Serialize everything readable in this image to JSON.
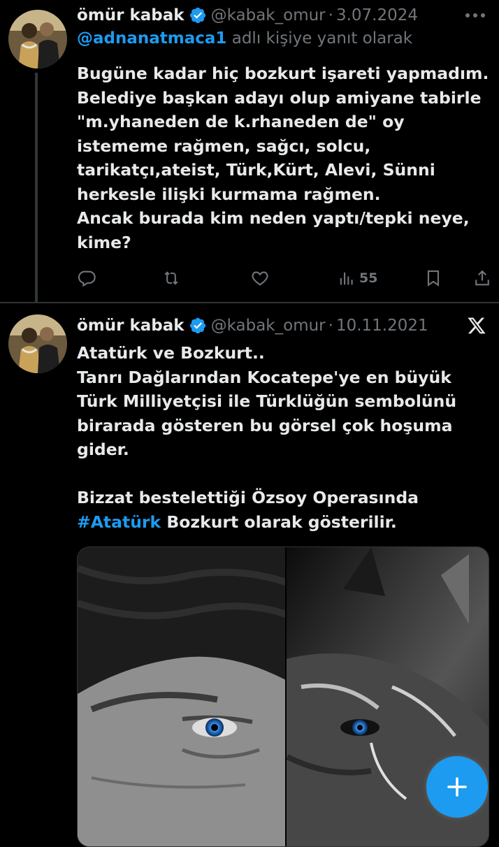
{
  "tweets": [
    {
      "author_name": "ömür kabak",
      "handle": "@kabak_omur",
      "separator": "·",
      "date": "3.07.2024",
      "reply_to_mention": "@adnanatmaca1",
      "reply_to_suffix": "adlı kişiye yanıt olarak",
      "lines": [
        "Bugüne kadar hiç bozkurt işareti yapmadım.",
        "Belediye başkan adayı olup amiyane tabirle",
        "\"m.yhaneden de k.rhaneden de\" oy",
        "istememe rağmen, sağcı, solcu,",
        "tarikatçı,ateist, Türk,Kürt, Alevi, Sünni",
        "herkesle ilişki kurmama rağmen.",
        "Ancak burada kim neden yaptı/tepki neye,",
        "kime?"
      ],
      "views_count": "55",
      "icons": {
        "reply": "reply-icon",
        "retweet": "retweet-icon",
        "like": "like-icon",
        "views": "views-icon",
        "bookmark": "bookmark-icon",
        "share": "share-icon",
        "more": "more-icon"
      }
    },
    {
      "author_name": "ömür kabak",
      "handle": "@kabak_omur",
      "separator": "·",
      "date": "10.11.2021",
      "lines": [
        "Atatürk ve Bozkurt..",
        "Tanrı Dağlarından Kocatepe'ye en büyük",
        "Türk Milliyetçisi ile Türklüğün sembolünü",
        "birarada gösteren bu görsel çok hoşuma",
        "gider.",
        "",
        "Bizzat bestelettiği Özsoy Operasında"
      ],
      "hashtag": "#Atatürk",
      "last_line_suffix": " Bozkurt olarak gösterilir.",
      "icons": {
        "source": "x-logo-icon",
        "verified": "verified-badge-icon"
      },
      "media_description_icon": "photo-media"
    }
  ],
  "fab": {
    "icon": "plus-icon",
    "color": "#1d9bf0"
  },
  "colors": {
    "background": "#000000",
    "text": "#e7e9ea",
    "secondary": "#71767b",
    "accent": "#1d9bf0",
    "divider": "#2f3336"
  }
}
